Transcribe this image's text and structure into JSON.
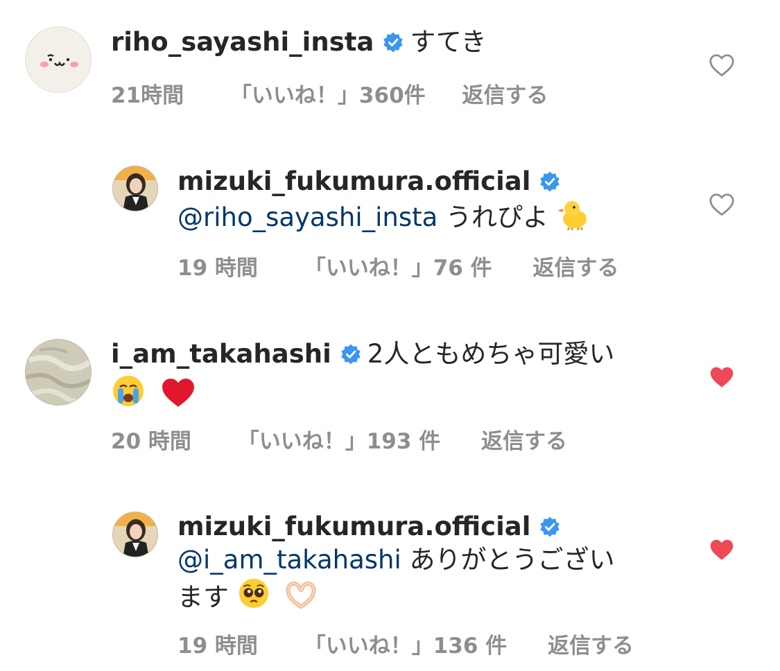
{
  "colors": {
    "verified": "#3897f0",
    "mention": "#00376b",
    "meta": "#8e8e8e",
    "heart_liked": "#ed4956",
    "heart_outline": "#8e8e8e"
  },
  "comments": [
    {
      "username": "riho_sayashi_insta",
      "text": "すてき",
      "time": "21時間",
      "likes": "「いいね！」360件",
      "reply_label": "返信する",
      "liked": false
    },
    {
      "username": "mizuki_fukumura.official",
      "mention": "@riho_sayashi_insta",
      "text": "うれぴよ",
      "emoji": "chick-emoji",
      "time": "19 時間",
      "likes": "「いいね！」76 件",
      "reply_label": "返信する",
      "liked": false
    },
    {
      "username": "i_am_takahashi",
      "text": "2人ともめちゃ可愛い",
      "emoji": "crying-face-emoji, red-heart-emoji",
      "time": "20 時間",
      "likes": "「いいね！」193 件",
      "reply_label": "返信する",
      "liked": true
    },
    {
      "username": "mizuki_fukumura.official",
      "mention": "@i_am_takahashi",
      "text": "ありがとうござい",
      "text2": "ます",
      "emoji": "pleading-face-emoji, heart-hands-emoji",
      "time": "19 時間",
      "likes": "「いいね！」136 件",
      "reply_label": "返信する",
      "liked": true
    }
  ]
}
